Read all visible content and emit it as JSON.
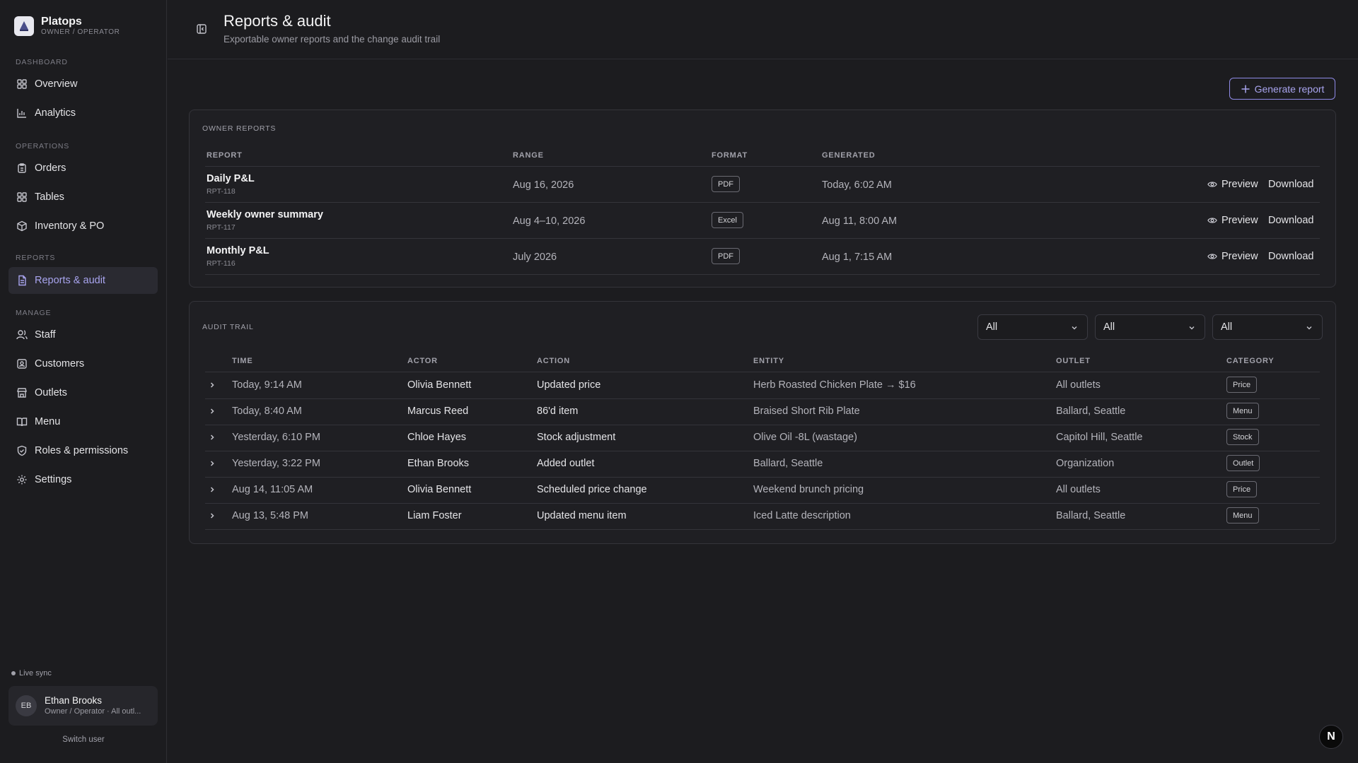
{
  "brand": {
    "name": "Platops",
    "subtitle": "OWNER / OPERATOR"
  },
  "nav": {
    "sections": [
      "DASHBOARD",
      "OPERATIONS",
      "REPORTS",
      "MANAGE"
    ],
    "items": [
      {
        "label": "Overview",
        "icon": "grid-icon"
      },
      {
        "label": "Analytics",
        "icon": "bar-chart-icon"
      },
      {
        "label": "Orders",
        "icon": "clipboard-icon"
      },
      {
        "label": "Tables",
        "icon": "grid-icon"
      },
      {
        "label": "Inventory & PO",
        "icon": "package-icon"
      },
      {
        "label": "Reports & audit",
        "icon": "file-icon",
        "active": true
      },
      {
        "label": "Staff",
        "icon": "users-icon"
      },
      {
        "label": "Customers",
        "icon": "contact-icon"
      },
      {
        "label": "Outlets",
        "icon": "store-icon"
      },
      {
        "label": "Menu",
        "icon": "book-icon"
      },
      {
        "label": "Roles & permissions",
        "icon": "shield-icon"
      },
      {
        "label": "Settings",
        "icon": "gear-icon"
      }
    ]
  },
  "status": {
    "live_sync": "Live sync"
  },
  "user": {
    "initials": "EB",
    "name": "Ethan Brooks",
    "role": "Owner / Operator · All outl...",
    "switch_label": "Switch user"
  },
  "header": {
    "title": "Reports & audit",
    "subtitle": "Exportable owner reports and the change audit trail"
  },
  "actions": {
    "generate_label": "Generate report"
  },
  "owner_reports": {
    "title": "OWNER REPORTS",
    "columns": [
      "REPORT",
      "RANGE",
      "FORMAT",
      "GENERATED"
    ],
    "preview_label": "Preview",
    "download_label": "Download",
    "rows": [
      {
        "name": "Daily P&L",
        "id": "RPT-118",
        "range": "Aug 16, 2026",
        "format": "PDF",
        "generated": "Today, 6:02 AM"
      },
      {
        "name": "Weekly owner summary",
        "id": "RPT-117",
        "range": "Aug 4–10, 2026",
        "format": "Excel",
        "generated": "Aug 11, 8:00 AM"
      },
      {
        "name": "Monthly P&L",
        "id": "RPT-116",
        "range": "July 2026",
        "format": "PDF",
        "generated": "Aug 1, 7:15 AM"
      }
    ]
  },
  "audit": {
    "title": "AUDIT TRAIL",
    "filters": [
      "All",
      "All",
      "All"
    ],
    "columns": [
      "TIME",
      "ACTOR",
      "ACTION",
      "ENTITY",
      "OUTLET",
      "CATEGORY"
    ],
    "rows": [
      {
        "time": "Today, 9:14 AM",
        "actor": "Olivia Bennett",
        "action": "Updated price",
        "entity": "Herb Roasted Chicken Plate → $16",
        "outlet": "All outlets",
        "category": "Price"
      },
      {
        "time": "Today, 8:40 AM",
        "actor": "Marcus Reed",
        "action": "86'd item",
        "entity": "Braised Short Rib Plate",
        "outlet": "Ballard, Seattle",
        "category": "Menu"
      },
      {
        "time": "Yesterday, 6:10 PM",
        "actor": "Chloe Hayes",
        "action": "Stock adjustment",
        "entity": "Olive Oil -8L (wastage)",
        "outlet": "Capitol Hill, Seattle",
        "category": "Stock"
      },
      {
        "time": "Yesterday, 3:22 PM",
        "actor": "Ethan Brooks",
        "action": "Added outlet",
        "entity": "Ballard, Seattle",
        "outlet": "Organization",
        "category": "Outlet"
      },
      {
        "time": "Aug 14, 11:05 AM",
        "actor": "Olivia Bennett",
        "action": "Scheduled price change",
        "entity": "Weekend brunch pricing",
        "outlet": "All outlets",
        "category": "Price"
      },
      {
        "time": "Aug 13, 5:48 PM",
        "actor": "Liam Foster",
        "action": "Updated menu item",
        "entity": "Iced Latte description",
        "outlet": "Ballard, Seattle",
        "category": "Menu"
      }
    ]
  },
  "corner_badge": "N"
}
